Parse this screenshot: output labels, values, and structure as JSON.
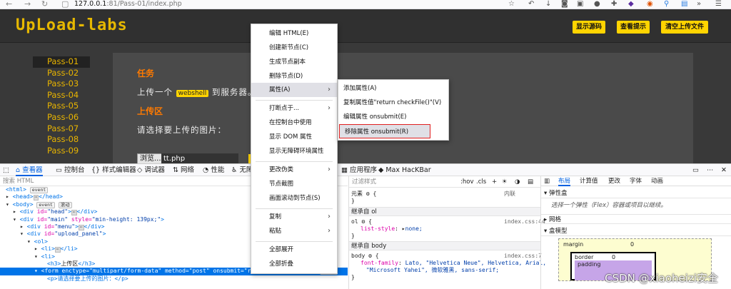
{
  "browser": {
    "url_host": "127.0.0.1",
    "url_path": ":81/Pass-01/index.php"
  },
  "site": {
    "logo": "UpLoad-labs",
    "header_buttons": [
      "显示源码",
      "查看提示",
      "清空上传文件"
    ],
    "menu": [
      "Pass-01",
      "Pass-02",
      "Pass-03",
      "Pass-04",
      "Pass-05",
      "Pass-06",
      "Pass-07",
      "Pass-08",
      "Pass-09"
    ],
    "task_title": "任务",
    "task_text_before": "上传一个",
    "task_badge": "webshell",
    "task_text_after": "到服务器。",
    "upload_title": "上传区",
    "upload_prompt": "请选择要上传的图片：",
    "browse_label": "浏览...",
    "file_name": "tt.php"
  },
  "devtools": {
    "tabs": [
      "查看器",
      "控制台",
      "样式编辑器",
      "调试器",
      "网络",
      "性能",
      "无障",
      "应用程序",
      "Max HacKBar"
    ],
    "search_placeholder": "搜索 HTML",
    "tree": {
      "l1": "<html>",
      "l2": "<head>",
      "l2b": "</head>",
      "l3": "<body>",
      "l4_tag": "<div",
      "l4_attr": "id=",
      "l4_val": "\"head\"",
      "l5_val": "\"main\"",
      "l5_style": "style=",
      "l5_style_val": "\"min-height: 139px;\"",
      "l6_val": "\"menu\"",
      "l7_val": "\"upload_panel\"",
      "l8": "<ol>",
      "l9": "<li>",
      "l10_open": "<h3>",
      "l10_text": "上传区",
      "l10_close": "</h3>",
      "l11": "<form enctype=\"multipart/form-data\" method=\"post\" onsubmit=\"return checkFile()\">",
      "l12": "<p>请选择要上传的图片：</p>",
      "event": "event",
      "scroll": "滚动",
      "close_div": "</div>",
      "close_li": "</li>"
    },
    "rules": {
      "filter": "过滤样式",
      "hov": ":hov",
      "cls": ".cls",
      "element_label": "元素",
      "inline": "内联",
      "inherit_ol": "继承自 ol",
      "ol_selector": "ol",
      "ol_prop": "list-style",
      "ol_val": "none;",
      "ol_src": "index.css:44",
      "inherit_body": "继承自 body",
      "body_selector": "body",
      "body_prop": "font-family",
      "body_val1": "Lato, \"Helvetica Neue\", Helvetica, Arial,",
      "body_val2": "\"Microsoft Yahei\", 微软雅黑, sans-serif;",
      "body_src": "index.css:7"
    },
    "layout": {
      "tabs": [
        "布局",
        "计算值",
        "更改",
        "字体",
        "动画"
      ],
      "flex_title": "弹性盒",
      "flex_hint": "选择一个弹性（Flex）容器或项目以继续。",
      "grid_title": "网格",
      "box_title": "盒模型",
      "margin": "margin",
      "border": "border",
      "padding": "padding",
      "zero": "0"
    }
  },
  "context_menu": {
    "items": [
      "编辑 HTML(E)",
      "创建新节点(C)",
      "生成节点副本",
      "删除节点(D)",
      "属性(A)",
      "打断点于...",
      "在控制台中使用",
      "显示 DOM 属性",
      "显示无障碍环境属性",
      "更改伪类",
      "节点截图",
      "画面滚动到节点(S)",
      "复制",
      "粘贴",
      "全部展开",
      "全部折叠"
    ]
  },
  "submenu": {
    "items": [
      "添加属性(A)",
      "复制属性值\"return checkFile()\"(V)",
      "编辑属性 onsubmit(E)",
      "移除属性 onsubmit(R)"
    ]
  },
  "watermark": "CSDN @xiaoheizi安全",
  "colors": {
    "accent_yellow": "#ffd400",
    "menu_text": "#e8b400",
    "section_title": "#ff7a00",
    "devtools_blue": "#0074e8"
  }
}
